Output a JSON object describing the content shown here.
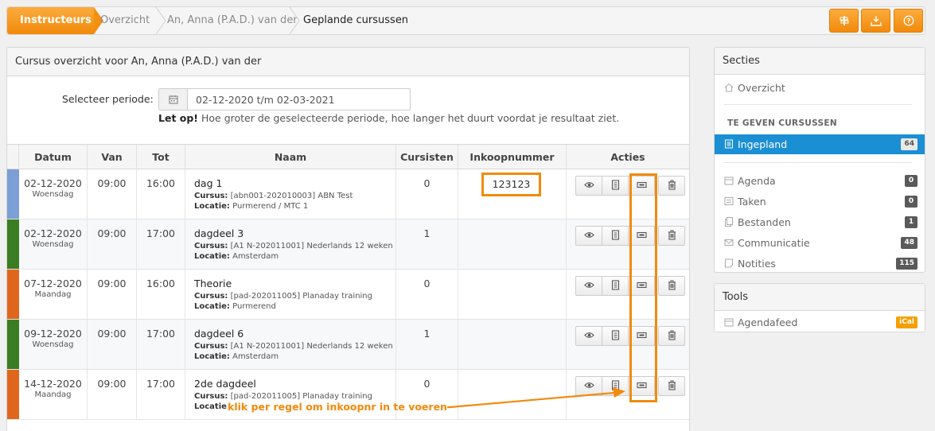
{
  "breadcrumb": {
    "items": [
      {
        "label": "Instructeurs"
      },
      {
        "label": "Overzicht"
      },
      {
        "label": "An, Anna (P.A.D.) van der"
      },
      {
        "label": "Geplande cursussen"
      }
    ]
  },
  "toolbar": {
    "buttons": [
      {
        "icon": "signpost-icon"
      },
      {
        "icon": "download-icon"
      },
      {
        "icon": "help-icon"
      }
    ]
  },
  "main": {
    "title": "Cursus overzicht voor An, Anna (P.A.D.) van der",
    "period_label": "Selecteer periode:",
    "period_value": "02-12-2020 t/m 02-03-2021",
    "warning_bold": "Let op!",
    "warning_text": " Hoe groter de geselecteerde periode, hoe langer het duurt voordat je resultaat ziet.",
    "columns": [
      "Datum",
      "Van",
      "Tot",
      "Naam",
      "Cursisten",
      "Inkoopnummer",
      "Acties"
    ],
    "course_label": "Cursus:",
    "location_label": "Locatie:",
    "rows": [
      {
        "color": "#7b9fd6",
        "date": "02-12-2020",
        "day": "Woensdag",
        "van": "09:00",
        "tot": "16:00",
        "name": "dag 1",
        "course": " [abn001-202010003] ABN Test",
        "location": " Purmerend / MTC 1",
        "count": "0",
        "purchase": "123123"
      },
      {
        "color": "#3a7d22",
        "date": "02-12-2020",
        "day": "Woensdag",
        "van": "09:00",
        "tot": "17:00",
        "name": "dagdeel 3",
        "course": " [A1 N-202011001] Nederlands 12 weken",
        "location": " Amsterdam",
        "count": "1",
        "purchase": ""
      },
      {
        "color": "#e0661d",
        "date": "07-12-2020",
        "day": "Maandag",
        "van": "09:00",
        "tot": "16:00",
        "name": "Theorie",
        "course": " [pad-202011005] Planaday training",
        "location": " Purmerend",
        "count": "0",
        "purchase": ""
      },
      {
        "color": "#3a7d22",
        "date": "09-12-2020",
        "day": "Woensdag",
        "van": "09:00",
        "tot": "17:00",
        "name": "dagdeel 6",
        "course": " [A1 N-202011001] Nederlands 12 weken",
        "location": " Amsterdam",
        "count": "1",
        "purchase": ""
      },
      {
        "color": "#e0661d",
        "date": "14-12-2020",
        "day": "Maandag",
        "van": "09:00",
        "tot": "17:00",
        "name": "2de dagdeel",
        "course": " [pad-202011005] Planaday training",
        "location": "",
        "count": "0",
        "purchase": ""
      }
    ]
  },
  "annotation": {
    "text": "klik per regel om inkoopnr in te voeren",
    "color": "#f28a0c"
  },
  "sidebar": {
    "title": "Secties",
    "overview": "Overzicht",
    "section_label": "TE GEVEN CURSUSSEN",
    "planned": {
      "label": "Ingepland",
      "count": "64"
    },
    "items": [
      {
        "label": "Agenda",
        "count": "0",
        "icon": "calendar-icon"
      },
      {
        "label": "Taken",
        "count": "0",
        "icon": "tasks-icon"
      },
      {
        "label": "Bestanden",
        "count": "1",
        "icon": "files-icon"
      },
      {
        "label": "Communicatie",
        "count": "48",
        "icon": "mail-icon"
      },
      {
        "label": "Notities",
        "count": "115",
        "icon": "notes-icon"
      }
    ]
  },
  "tools": {
    "title": "Tools",
    "feed": {
      "label": "Agendafeed",
      "badge": "iCal"
    }
  }
}
